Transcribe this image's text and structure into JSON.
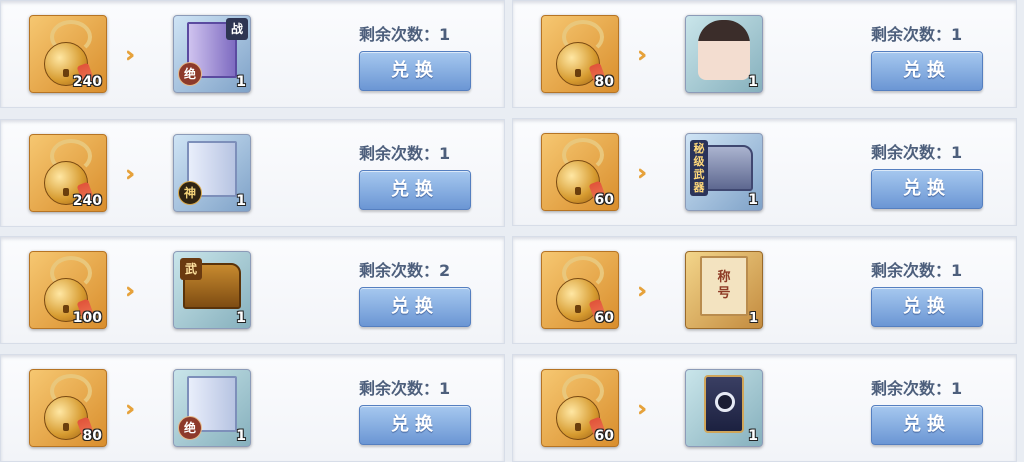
{
  "exchange_label": "兑换",
  "remaining_label": "剩余次数：",
  "left": [
    {
      "cost": "240",
      "reward_qty": "1",
      "remaining": "1",
      "reward": "ultimate-skill-book",
      "tag": "绝",
      "badge": "战"
    },
    {
      "cost": "240",
      "reward_qty": "1",
      "remaining": "1",
      "reward": "divine-skill-book",
      "tag": "神"
    },
    {
      "cost": "100",
      "reward_qty": "1",
      "remaining": "2",
      "reward": "treasure-chest",
      "tag": "武"
    },
    {
      "cost": "80",
      "reward_qty": "1",
      "remaining": "1",
      "reward": "ultimate-skill-book",
      "tag": "绝"
    }
  ],
  "right": [
    {
      "cost": "80",
      "reward_qty": "1",
      "remaining": "1",
      "reward": "character-portrait"
    },
    {
      "cost": "60",
      "reward_qty": "1",
      "remaining": "1",
      "reward": "silver-treasure-chest",
      "tag": "秘级武器"
    },
    {
      "cost": "60",
      "reward_qty": "1",
      "remaining": "1",
      "reward": "title-scroll",
      "scroll_text": "称号"
    },
    {
      "cost": "60",
      "reward_qty": "1",
      "remaining": "1",
      "reward": "card-back"
    }
  ],
  "colors": {
    "accent_button": "#6b96d4",
    "arrow": "#e6a23b",
    "text": "#4d5f7c"
  }
}
